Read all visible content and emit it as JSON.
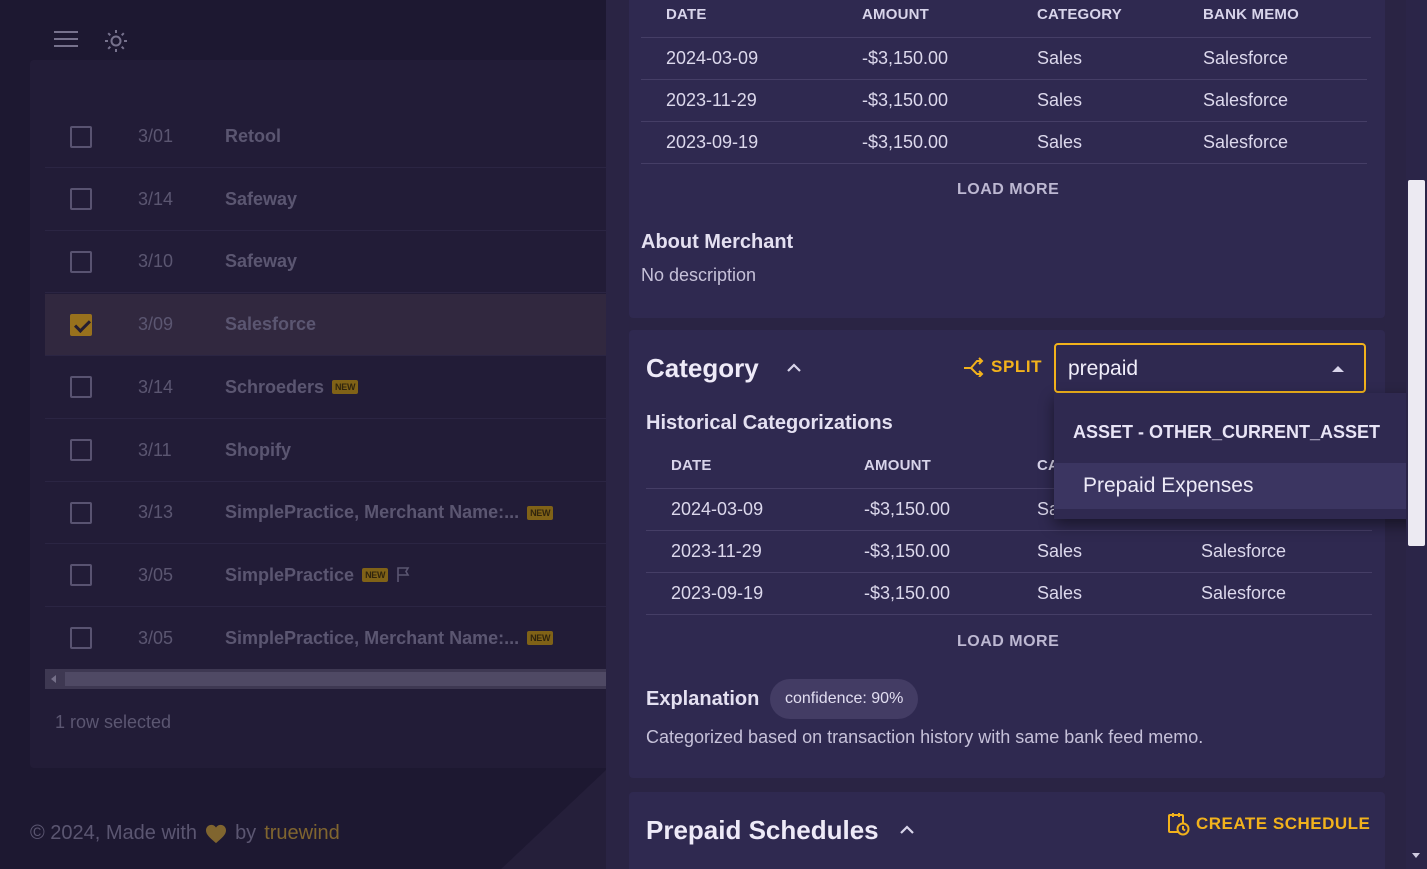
{
  "left": {
    "rows": [
      {
        "date": "3/01",
        "name": "Retool",
        "checked": false,
        "new": false,
        "flag": false
      },
      {
        "date": "3/14",
        "name": "Safeway",
        "checked": false,
        "new": false,
        "flag": false
      },
      {
        "date": "3/10",
        "name": "Safeway",
        "checked": false,
        "new": false,
        "flag": false
      },
      {
        "date": "3/09",
        "name": "Salesforce",
        "checked": true,
        "new": false,
        "flag": false
      },
      {
        "date": "3/14",
        "name": "Schroeders",
        "checked": false,
        "new": true,
        "flag": false
      },
      {
        "date": "3/11",
        "name": "Shopify",
        "checked": false,
        "new": false,
        "flag": false
      },
      {
        "date": "3/13",
        "name": "SimplePractice, Merchant Name:...",
        "checked": false,
        "new": true,
        "flag": false
      },
      {
        "date": "3/05",
        "name": "SimplePractice",
        "checked": false,
        "new": true,
        "flag": true
      },
      {
        "date": "3/05",
        "name": "SimplePractice, Merchant Name:...",
        "checked": false,
        "new": true,
        "flag": false
      }
    ],
    "new_badge": "NEW",
    "rows_selected": "1 row selected",
    "footer": {
      "prefix": "© 2024, Made with",
      "by": "by",
      "brand": "truewind"
    }
  },
  "merchant": {
    "table": {
      "headers": [
        "DATE",
        "AMOUNT",
        "CATEGORY",
        "BANK MEMO"
      ],
      "rows": [
        [
          "2024-03-09",
          "-$3,150.00",
          "Sales",
          "Salesforce"
        ],
        [
          "2023-11-29",
          "-$3,150.00",
          "Sales",
          "Salesforce"
        ],
        [
          "2023-09-19",
          "-$3,150.00",
          "Sales",
          "Salesforce"
        ]
      ]
    },
    "load_more": "LOAD MORE",
    "about_title": "About Merchant",
    "about_text": "No description"
  },
  "category": {
    "title": "Category",
    "split_label": "SPLIT",
    "input_value": "prepaid",
    "historical_title": "Historical Categorizations",
    "headers": [
      "DATE",
      "AMOUNT",
      "CA"
    ],
    "rows": [
      [
        "2024-03-09",
        "-$3,150.00",
        "Sa",
        ""
      ],
      [
        "2023-11-29",
        "-$3,150.00",
        "Sales",
        "Salesforce"
      ],
      [
        "2023-09-19",
        "-$3,150.00",
        "Sales",
        "Salesforce"
      ]
    ],
    "load_more": "LOAD MORE",
    "explanation_title": "Explanation",
    "confidence": "confidence: 90%",
    "explanation_text": "Categorized based on transaction history with same bank feed memo.",
    "dropdown": {
      "group": "ASSET - OTHER_CURRENT_ASSET",
      "option": "Prepaid Expenses"
    }
  },
  "prepaid": {
    "title": "Prepaid Schedules",
    "create_label": "CREATE SCHEDULE"
  },
  "colors": {
    "accent": "#f2b21c",
    "background": "#221d38",
    "card": "#2f2950"
  }
}
